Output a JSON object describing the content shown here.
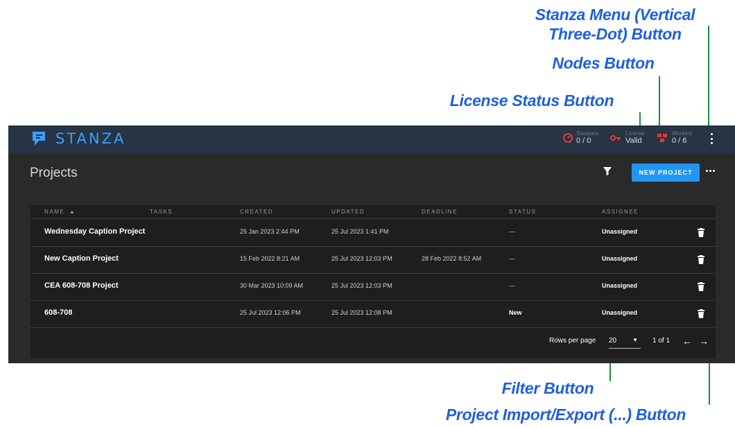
{
  "callouts": {
    "stanza_menu": "Stanza Menu (Vertical Three-Dot) Button",
    "nodes": "Nodes Button",
    "license": "License Status Button",
    "filter": "Filter Button",
    "import_export": "Project Import/Export (...) Button"
  },
  "app": {
    "brand": "STANZA",
    "sessions": {
      "label": "Sessions",
      "value": "0 / 0"
    },
    "license": {
      "label": "License",
      "value": "Valid"
    },
    "workers": {
      "label": "Workers",
      "value": "0 / 6"
    }
  },
  "page": {
    "title": "Projects",
    "new_project": "NEW PROJECT"
  },
  "table": {
    "headers": {
      "name": "NAME",
      "sort_icon": "sort-ascending-icon",
      "tasks": "TASKS",
      "created": "CREATED",
      "updated": "UPDATED",
      "deadline": "DEADLINE",
      "status": "STATUS",
      "assignee": "ASSIGNEE"
    },
    "rows": [
      {
        "name": "Wednesday Caption Project",
        "created": "25 Jan 2023 2:44 PM",
        "updated": "25 Jul 2023 1:41 PM",
        "deadline": "",
        "status": "—",
        "assignee": "Unassigned"
      },
      {
        "name": "New Caption Project",
        "created": "15 Feb 2022 8:21 AM",
        "updated": "25 Jul 2023 12:03 PM",
        "deadline": "28 Feb 2022 8:52 AM",
        "status": "—",
        "assignee": "Unassigned"
      },
      {
        "name": "CEA 608-708 Project",
        "created": "30 Mar 2023 10:09 AM",
        "updated": "25 Jul 2023 12:03 PM",
        "deadline": "",
        "status": "—",
        "assignee": "Unassigned"
      },
      {
        "name": "608-708",
        "created": "25 Jul 2023 12:06 PM",
        "updated": "25 Jul 2023 12:08 PM",
        "deadline": "",
        "status": "New",
        "assignee": "Unassigned"
      }
    ],
    "footer": {
      "rows_per_page_label": "Rows per page",
      "rows_per_page_value": "20",
      "page_info": "1 of 1",
      "prev": "←",
      "next": "→"
    }
  },
  "colors": {
    "callout_text": "#1f5fe0",
    "leader_line": "#1e8f3a",
    "topbar": "#263443",
    "brand": "#3aa0ff",
    "accent_button": "#2196f3",
    "alert_icon": "#e53935"
  }
}
